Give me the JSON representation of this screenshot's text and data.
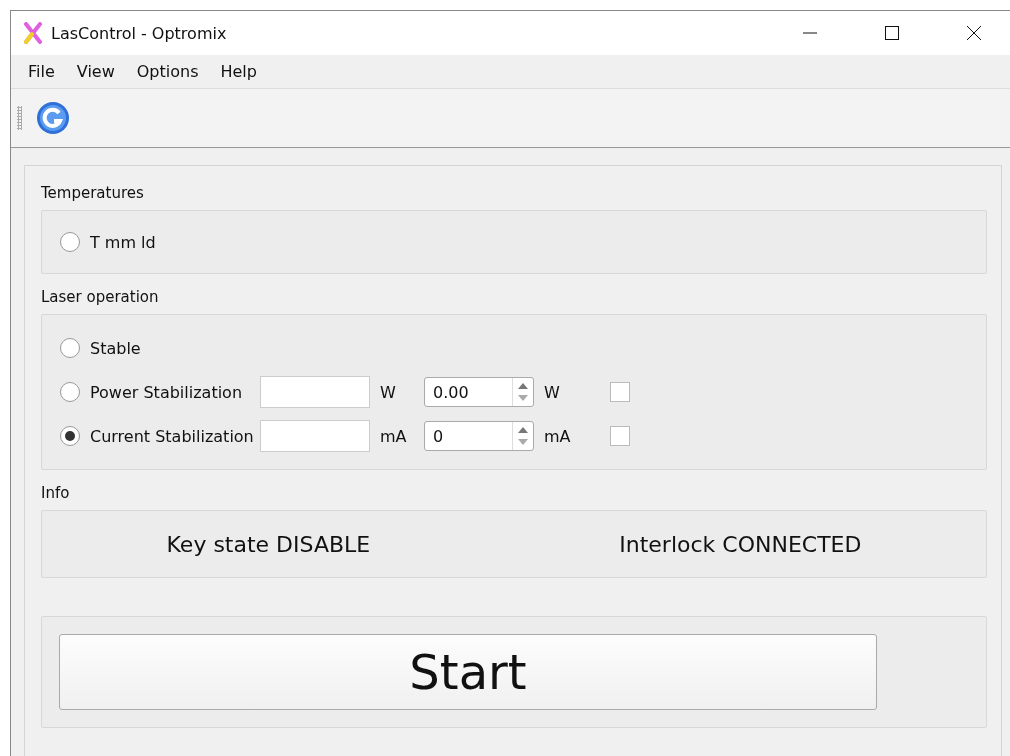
{
  "window": {
    "title": "LasControl - Optromix"
  },
  "menu": [
    "File",
    "View",
    "Options",
    "Help"
  ],
  "temperatures": {
    "title": "Temperatures",
    "options": [
      {
        "label": "T mm ld",
        "selected": false
      }
    ]
  },
  "laser_operation": {
    "title": "Laser operation",
    "modes": [
      {
        "kind": "plain",
        "label": "Stable",
        "selected": false
      },
      {
        "kind": "stabilization",
        "label": "Power Stabilization",
        "selected": false,
        "unit": "W",
        "spin_value": "0.00",
        "spin_unit": "W",
        "checked": false
      },
      {
        "kind": "stabilization",
        "label": "Current Stabilization",
        "selected": true,
        "unit": "mA",
        "spin_value": "0",
        "spin_unit": "mA",
        "checked": false
      }
    ]
  },
  "info": {
    "title": "Info",
    "items": [
      "Key state DISABLE",
      "Interlock CONNECTED"
    ]
  },
  "start_button": "Start"
}
